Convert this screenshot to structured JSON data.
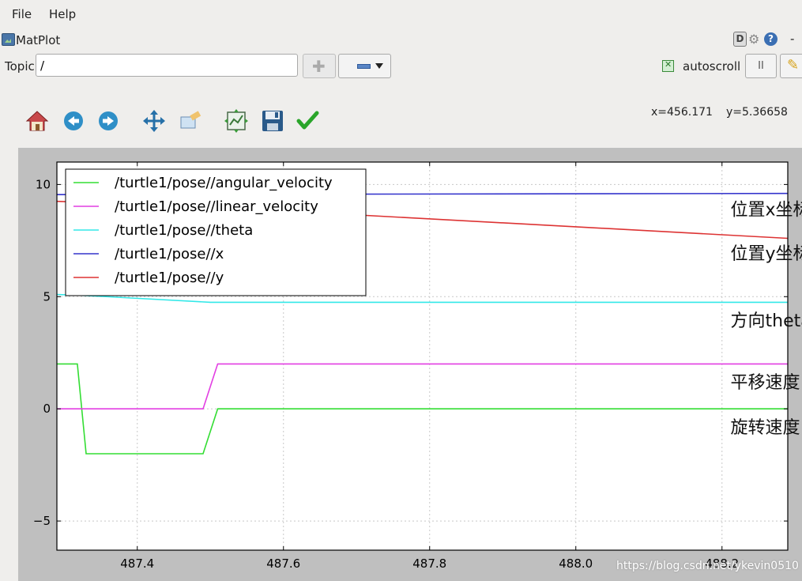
{
  "menu": {
    "file": "File",
    "help": "Help"
  },
  "window": {
    "title": "MatPlot",
    "ctrl_d": "D",
    "ctrl_help": "?",
    "ctrl_dash": "-"
  },
  "topic": {
    "label": "Topic",
    "value": "/"
  },
  "autoscroll": {
    "label": "autoscroll",
    "checked": true
  },
  "pause_label": "II",
  "toolbar": {
    "icons": [
      "home-icon",
      "back-icon",
      "forward-icon",
      "pan-icon",
      "zoom-icon",
      "configure-subplots-icon",
      "save-icon",
      "edit-check-icon"
    ]
  },
  "coords": {
    "x": "x=456.171",
    "y": "y=5.36658"
  },
  "chart_data": {
    "type": "line",
    "xlim": [
      487.29,
      488.29
    ],
    "ylim": [
      -6.3,
      11.0
    ],
    "x_ticks": [
      487.4,
      487.6,
      487.8,
      488.0,
      488.2
    ],
    "x_tick_labels": [
      "487.4",
      "487.6",
      "487.8",
      "488.0",
      "488.2"
    ],
    "y_ticks": [
      -5,
      0,
      5,
      10
    ],
    "y_tick_labels": [
      "−5",
      "0",
      "5",
      "10"
    ],
    "grid": true,
    "legend_position": "top-left",
    "series": [
      {
        "name": "/turtle1/pose//angular_velocity",
        "color": "#33dd33",
        "x": [
          487.29,
          487.318,
          487.33,
          487.49,
          487.51,
          488.29
        ],
        "y": [
          2.0,
          2.0,
          -2.0,
          -2.0,
          0.0,
          0.0
        ]
      },
      {
        "name": "/turtle1/pose//linear_velocity",
        "color": "#e23ee2",
        "x": [
          487.29,
          487.49,
          487.51,
          488.29
        ],
        "y": [
          0.0,
          0.0,
          2.0,
          2.0
        ]
      },
      {
        "name": "/turtle1/pose//theta",
        "color": "#33e8e8",
        "x": [
          487.29,
          487.33,
          487.5,
          488.29
        ],
        "y": [
          5.1,
          5.05,
          4.75,
          4.75
        ]
      },
      {
        "name": "/turtle1/pose//x",
        "color": "#3333cc",
        "x": [
          487.29,
          488.29
        ],
        "y": [
          9.55,
          9.6
        ]
      },
      {
        "name": "/turtle1/pose//y",
        "color": "#dd3333",
        "x": [
          487.29,
          487.5,
          488.29
        ],
        "y": [
          9.25,
          9.0,
          7.6
        ]
      }
    ],
    "annotations": [
      {
        "text": "位置x坐标",
        "x": 488.35,
        "y": 8.9
      },
      {
        "text": "位置y坐标",
        "x": 488.35,
        "y": 6.95
      },
      {
        "text": "方向theta",
        "x": 488.35,
        "y": 3.95
      },
      {
        "text": "平移速度",
        "x": 488.35,
        "y": 1.2
      },
      {
        "text": "旋转速度",
        "x": 488.35,
        "y": -0.8
      }
    ]
  },
  "watermark": "https://blog.csdn.net/ykevin0510"
}
